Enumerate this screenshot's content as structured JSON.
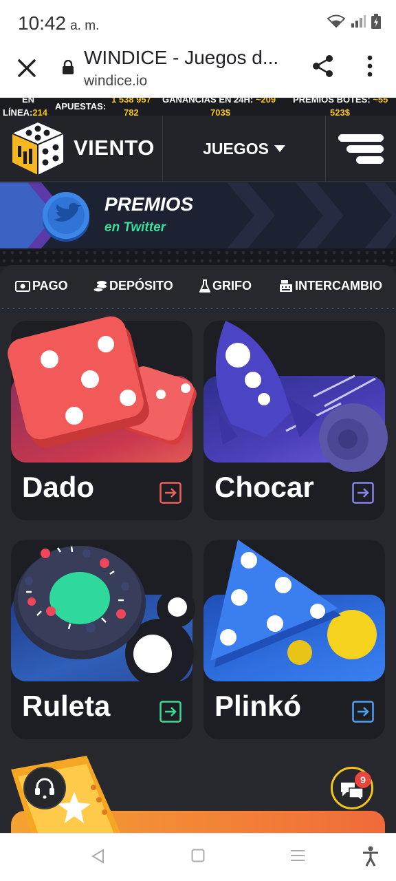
{
  "status_bar": {
    "time": "10:42",
    "ampm": "a. m."
  },
  "browser": {
    "title": "WINDICE - Juegos d...",
    "url": "windice.io"
  },
  "ticker": {
    "online_label_1": "EN",
    "online_label_2": "LÍNEA:",
    "online_value": "214",
    "bets_label": "APUESTAS:",
    "bets_value_1": "1 538 957",
    "bets_value_2": "782",
    "wins_label": "GANANCIAS EN 24H:",
    "wins_value_1": "~209",
    "wins_value_2": "703$",
    "jackpot_label": "PREMIOS BOTES:",
    "jackpot_value_1": "~55",
    "jackpot_value_2": "523$"
  },
  "header": {
    "brand": "VIENTO",
    "games_label": "JUEGOS"
  },
  "banner": {
    "title": "PREMIOS",
    "subtitle": "en Twitter"
  },
  "wallet_nav": [
    {
      "label": "PAGO",
      "icon": "cash-icon"
    },
    {
      "label": "DEPÓSITO",
      "icon": "coins-icon"
    },
    {
      "label": "GRIFO",
      "icon": "flask-icon"
    },
    {
      "label": "INTERCAMBIO",
      "icon": "register-icon"
    }
  ],
  "games": [
    {
      "label": "Dado",
      "accent": "#f0605a"
    },
    {
      "label": "Chocar",
      "accent": "#8a86e8"
    },
    {
      "label": "Ruleta",
      "accent": "#3ddc97"
    },
    {
      "label": "Plinkó",
      "accent": "#4ea3f5"
    }
  ],
  "chat": {
    "badge": "9"
  },
  "colors": {
    "background": "#23242a",
    "ticker_value": "#f5c518",
    "twitter_green": "#3ddc97"
  }
}
